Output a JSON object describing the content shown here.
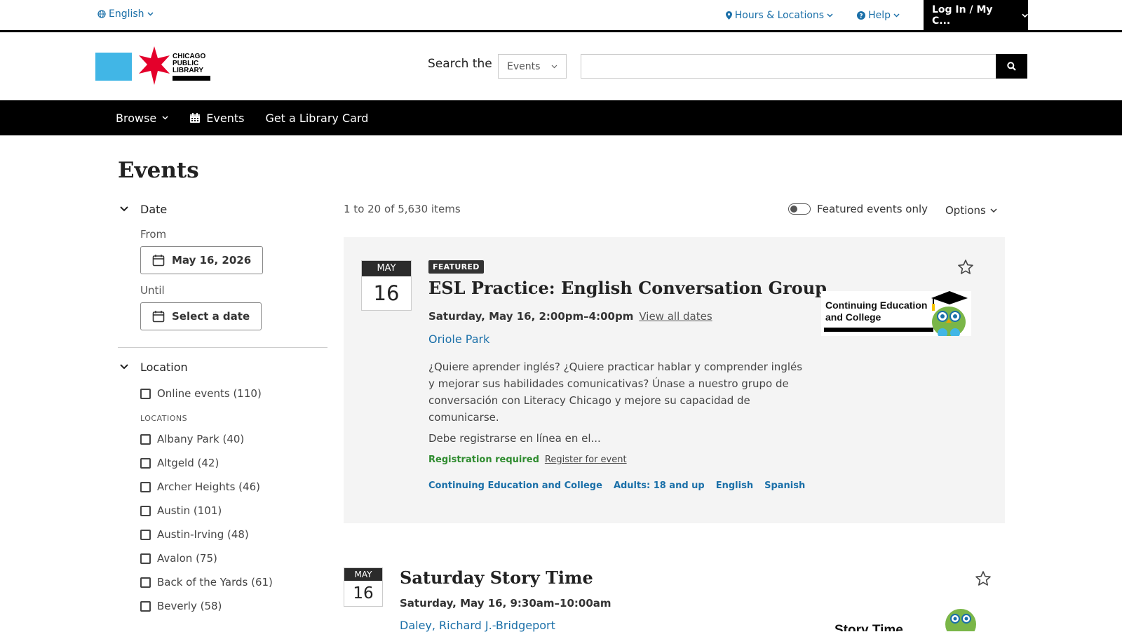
{
  "utility": {
    "language": "English",
    "hours_locations": "Hours & Locations",
    "help": "Help",
    "login": "Log In / My C..."
  },
  "header": {
    "logo_text": "CHICAGO PUBLIC LIBRARY",
    "search_label": "Search the",
    "search_scope": "Events",
    "search_value": ""
  },
  "nav": {
    "browse": "Browse",
    "events": "Events",
    "library_card": "Get a Library Card"
  },
  "page": {
    "title": "Events"
  },
  "filters": {
    "date_heading": "Date",
    "from_label": "From",
    "from_value": "May 16, 2026",
    "until_label": "Until",
    "until_value": "Select a date",
    "location_heading": "Location",
    "online": "Online events (110)",
    "locations_subhead": "LOCATIONS",
    "locations": [
      "Albany Park (40)",
      "Altgeld (42)",
      "Archer Heights (46)",
      "Austin (101)",
      "Austin-Irving (48)",
      "Avalon (75)",
      "Back of the Yards (61)",
      "Beverly (58)"
    ]
  },
  "results": {
    "count": "1 to 20 of 5,630 items",
    "featured_only": "Featured events only",
    "featured_only_on": false,
    "options": "Options"
  },
  "events": [
    {
      "month": "MAY",
      "day": "16",
      "badge": "FEATURED",
      "title": "ESL Practice: English Conversation Group",
      "time": "Saturday, May 16, 2:00pm–4:00pm",
      "view_all": "View all dates",
      "location": "Oriole Park",
      "description": "¿Quiere aprender inglés? ¿Quiere practicar hablar y comprender inglés y mejorar sus habilidades comunicativas? Únase a nuestro grupo de conversación con Literacy Chicago y mejore su capacidad de comunicarse.",
      "description2": "Debe registrarse en línea en el...",
      "registration": "Registration required",
      "register_link": "Register for event",
      "tags": [
        "Continuing Education and College",
        "Adults: 18 and up",
        "English",
        "Spanish"
      ],
      "thumb_text": "Continuing Education and College"
    },
    {
      "month": "MAY",
      "day": "16",
      "title": "Saturday Story Time",
      "time": "Saturday, May 16, 9:30am–10:00am",
      "location": "Daley, Richard J.-Bridgeport",
      "thumb_text": "Story Time"
    }
  ],
  "colors": {
    "link_blue": "#1a6fa8",
    "logo_blue": "#41b6e6",
    "logo_red": "#e4002b",
    "green": "#2e8b2e"
  }
}
